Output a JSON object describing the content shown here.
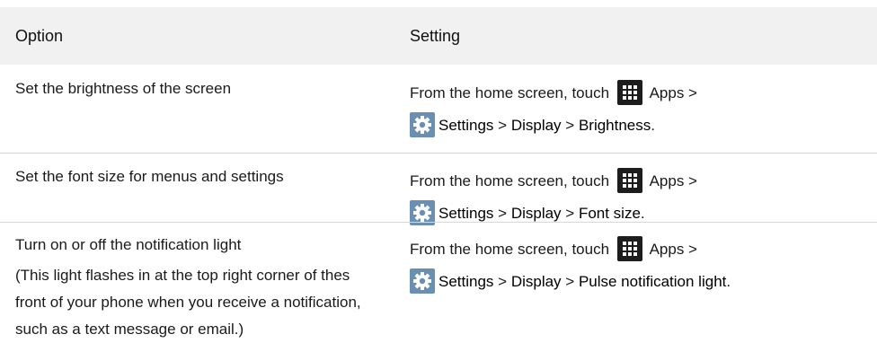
{
  "table": {
    "headers": {
      "option": "Option",
      "setting": "Setting"
    },
    "rows": [
      {
        "option": "Set the brightness of the screen",
        "note": "",
        "prefix": "From the home screen, touch",
        "apps": "Apps >",
        "settings": "Settings",
        "sep1": " > ",
        "display": "Display",
        "sep2": " > ",
        "target": "Brightness",
        "end": "."
      },
      {
        "option": "Set the font size for menus and settings",
        "note": "",
        "prefix": "From the home screen, touch",
        "apps": "Apps >",
        "settings": "Settings",
        "sep1": " > ",
        "display": "Display",
        "sep2": " > ",
        "target": "Font size",
        "end": "."
      },
      {
        "option": "Turn on or off the notification light",
        "note": "(This light flashes in at the top right corner of thes front of your phone when you receive a notification, such as a text message or email.)",
        "prefix": "From the home screen, touch",
        "apps": "Apps >",
        "settings": "Settings",
        "sep1": " > ",
        "display": "Display",
        "sep2": " > ",
        "target": "Pulse notification light",
        "end": "."
      }
    ]
  },
  "icons": {
    "apps": "apps-grid-icon",
    "settings": "gear-icon",
    "settings_color": "#6b8fb3",
    "apps_color": "#1d1d1d"
  }
}
